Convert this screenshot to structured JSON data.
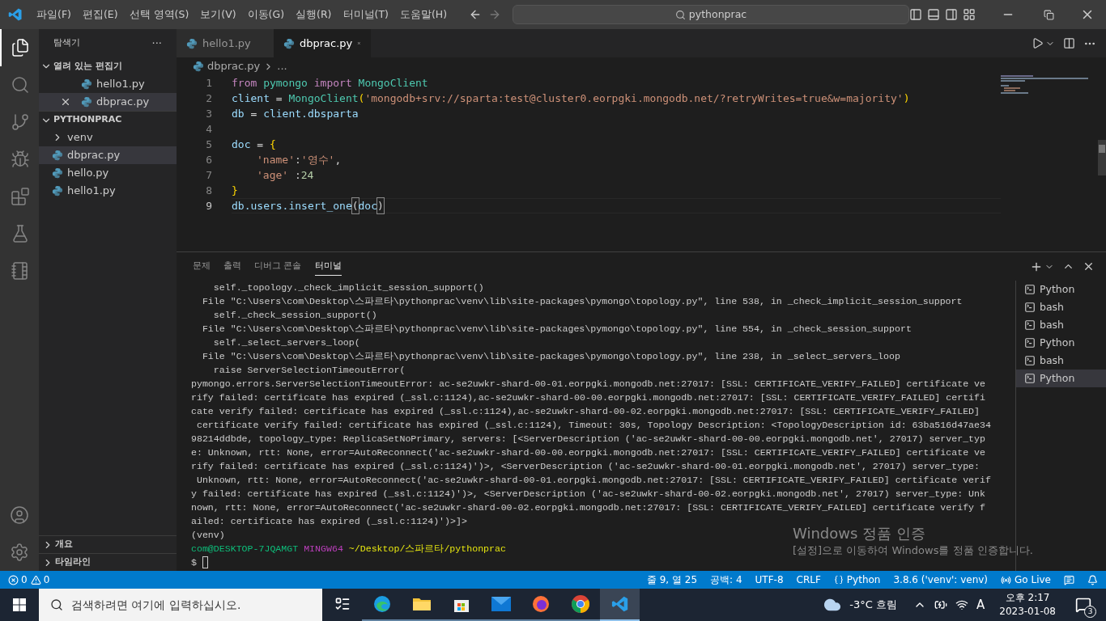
{
  "title_bar": {
    "menu": [
      "파일(F)",
      "편집(E)",
      "선택 영역(S)",
      "보기(V)",
      "이동(G)",
      "실행(R)",
      "터미널(T)",
      "도움말(H)"
    ],
    "search": "pythonprac"
  },
  "activity_bar": [
    {
      "kind": "files",
      "selected": true
    },
    {
      "kind": "search",
      "selected": false
    },
    {
      "kind": "git",
      "selected": false
    },
    {
      "kind": "debug",
      "selected": false
    },
    {
      "kind": "extensions",
      "selected": false
    },
    {
      "kind": "testing",
      "selected": false
    },
    {
      "kind": "notebook",
      "selected": false
    }
  ],
  "sidebar": {
    "title": "탐색기",
    "more": "···",
    "open_editors": {
      "label": "열려 있는 편집기",
      "expanded": true,
      "items": [
        {
          "name": "hello1.py",
          "selected": false
        },
        {
          "name": "dbprac.py",
          "selected": true
        }
      ]
    },
    "folder": {
      "label": "PYTHONPRAC",
      "expanded": true,
      "items": [
        {
          "name": "venv",
          "kind": "folder",
          "expanded": false,
          "selected": false
        },
        {
          "name": "dbprac.py",
          "kind": "file",
          "selected": true
        },
        {
          "name": "hello.py",
          "kind": "file",
          "selected": false
        },
        {
          "name": "hello1.py",
          "kind": "file",
          "selected": false
        }
      ]
    },
    "bottom_sections": [
      {
        "label": "개요",
        "expanded": false
      },
      {
        "label": "타임라인",
        "expanded": false
      }
    ]
  },
  "tabs": [
    {
      "name": "hello1.py",
      "selected": false
    },
    {
      "name": "dbprac.py",
      "selected": true
    }
  ],
  "breadcrumb": [
    "dbprac.py",
    "..."
  ],
  "code": [
    {
      "number": "1",
      "current": false,
      "tokens": [
        {
          "text": "from ",
          "kind": "keyword"
        },
        {
          "text": "pymongo ",
          "kind": "type"
        },
        {
          "text": "import ",
          "kind": "keyword"
        },
        {
          "text": "MongoClient",
          "kind": "type"
        }
      ]
    },
    {
      "number": "2",
      "current": false,
      "tokens": [
        {
          "text": "client",
          "kind": "var"
        },
        {
          "text": " = ",
          "kind": "plain"
        },
        {
          "text": "MongoClient",
          "kind": "type"
        },
        {
          "text": "(",
          "kind": "bracket"
        },
        {
          "text": "'mongodb+srv://sparta:test@cluster0.eorpgki.mongodb.net/?retryWrites=true&w=majority'",
          "kind": "string"
        },
        {
          "text": ")",
          "kind": "bracket"
        }
      ]
    },
    {
      "number": "3",
      "current": false,
      "tokens": [
        {
          "text": "db",
          "kind": "var"
        },
        {
          "text": " = ",
          "kind": "plain"
        },
        {
          "text": "client.dbsparta",
          "kind": "var"
        }
      ]
    },
    {
      "number": "4",
      "current": false
    },
    {
      "number": "5",
      "current": false,
      "tokens": [
        {
          "text": "doc",
          "kind": "var"
        },
        {
          "text": " = ",
          "kind": "plain"
        },
        {
          "text": "{",
          "kind": "bracket"
        }
      ]
    },
    {
      "number": "6",
      "current": false,
      "indented": true,
      "tokens": [
        {
          "text": "'name'",
          "kind": "string"
        },
        {
          "text": ":",
          "kind": "plain"
        },
        {
          "text": "'영수'",
          "kind": "string"
        },
        {
          "text": ",",
          "kind": "plain"
        }
      ]
    },
    {
      "number": "7",
      "current": false,
      "indented": true,
      "tokens": [
        {
          "text": "'age'",
          "kind": "string"
        },
        {
          "text": " :",
          "kind": "plain"
        },
        {
          "text": "24",
          "kind": "number"
        }
      ]
    },
    {
      "number": "8",
      "current": false,
      "tokens": [
        {
          "text": "}",
          "kind": "bracket"
        }
      ]
    },
    {
      "number": "9",
      "current": true,
      "tokens": [
        {
          "text": "db.users.insert_one",
          "kind": "var"
        },
        {
          "text": "(",
          "kind": "match"
        },
        {
          "text": "doc",
          "kind": "var"
        },
        {
          "text": ")",
          "kind": "match"
        }
      ]
    }
  ],
  "panel": {
    "tabs": [
      {
        "label": "문제",
        "selected": false
      },
      {
        "label": "출력",
        "selected": false
      },
      {
        "label": "디버그 콘솔",
        "selected": false
      },
      {
        "label": "터미널",
        "selected": true
      }
    ],
    "terminal": [
      [
        {
          "text": "    self._topology._check_implicit_session_support()",
          "kind": "plain"
        }
      ],
      [
        {
          "text": "  File \"C:\\Users\\com\\Desktop\\스파르타\\pythonprac\\venv\\lib\\site-packages\\pymongo\\topology.py\", line 538, in _check_implicit_session_support",
          "kind": "plain"
        }
      ],
      [
        {
          "text": "    self._check_session_support()",
          "kind": "plain"
        }
      ],
      [
        {
          "text": "  File \"C:\\Users\\com\\Desktop\\스파르타\\pythonprac\\venv\\lib\\site-packages\\pymongo\\topology.py\", line 554, in _check_session_support",
          "kind": "plain"
        }
      ],
      [
        {
          "text": "    self._select_servers_loop(",
          "kind": "plain"
        }
      ],
      [
        {
          "text": "  File \"C:\\Users\\com\\Desktop\\스파르타\\pythonprac\\venv\\lib\\site-packages\\pymongo\\topology.py\", line 238, in _select_servers_loop",
          "kind": "plain"
        }
      ],
      [
        {
          "text": "    raise ServerSelectionTimeoutError(",
          "kind": "plain"
        }
      ],
      [
        {
          "text": "pymongo.errors.ServerSelectionTimeoutError: ac-se2uwkr-shard-00-01.eorpgki.mongodb.net:27017: [SSL: CERTIFICATE_VERIFY_FAILED] certificate ve",
          "kind": "plain"
        }
      ],
      [
        {
          "text": "rify failed: certificate has expired (_ssl.c:1124),ac-se2uwkr-shard-00-00.eorpgki.mongodb.net:27017: [SSL: CERTIFICATE_VERIFY_FAILED] certifi",
          "kind": "plain"
        }
      ],
      [
        {
          "text": "cate verify failed: certificate has expired (_ssl.c:1124),ac-se2uwkr-shard-00-02.eorpgki.mongodb.net:27017: [SSL: CERTIFICATE_VERIFY_FAILED]",
          "kind": "plain"
        }
      ],
      [
        {
          "text": " certificate verify failed: certificate has expired (_ssl.c:1124), Timeout: 30s, Topology Description: <TopologyDescription id: 63ba516d47ae34",
          "kind": "plain"
        }
      ],
      [
        {
          "text": "98214ddbde, topology_type: ReplicaSetNoPrimary, servers: [<ServerDescription ('ac-se2uwkr-shard-00-00.eorpgki.mongodb.net', 27017) server_typ",
          "kind": "plain"
        }
      ],
      [
        {
          "text": "e: Unknown, rtt: None, error=AutoReconnect('ac-se2uwkr-shard-00-00.eorpgki.mongodb.net:27017: [SSL: CERTIFICATE_VERIFY_FAILED] certificate ve",
          "kind": "plain"
        }
      ],
      [
        {
          "text": "rify failed: certificate has expired (_ssl.c:1124)')>, <ServerDescription ('ac-se2uwkr-shard-00-01.eorpgki.mongodb.net', 27017) server_type:",
          "kind": "plain"
        }
      ],
      [
        {
          "text": " Unknown, rtt: None, error=AutoReconnect('ac-se2uwkr-shard-00-01.eorpgki.mongodb.net:27017: [SSL: CERTIFICATE_VERIFY_FAILED] certificate verif",
          "kind": "plain"
        }
      ],
      [
        {
          "text": "y failed: certificate has expired (_ssl.c:1124)')>, <ServerDescription ('ac-se2uwkr-shard-00-02.eorpgki.mongodb.net', 27017) server_type: Unk",
          "kind": "plain"
        }
      ],
      [
        {
          "text": "nown, rtt: None, error=AutoReconnect('ac-se2uwkr-shard-00-02.eorpgki.mongodb.net:27017: [SSL: CERTIFICATE_VERIFY_FAILED] certificate verify f",
          "kind": "plain"
        }
      ],
      [
        {
          "text": "ailed: certificate has expired (_ssl.c:1124)')>]>",
          "kind": "plain"
        }
      ],
      [
        {
          "text": "(venv)",
          "kind": "plain"
        }
      ],
      [
        {
          "text": "com@DESKTOP-7JQAMGT",
          "kind": "user"
        },
        {
          "text": " MINGW64",
          "kind": "system"
        },
        {
          "text": " ~/Desktop/스파르타/pythonprac",
          "kind": "path"
        }
      ],
      [
        {
          "text": "$ ",
          "kind": "plain"
        },
        {
          "kind": "cursor"
        }
      ]
    ],
    "sessions": [
      {
        "name": "Python",
        "selected": false
      },
      {
        "name": "bash",
        "selected": false
      },
      {
        "name": "bash",
        "selected": false
      },
      {
        "name": "Python",
        "selected": false
      },
      {
        "name": "bash",
        "selected": false
      },
      {
        "name": "Python",
        "selected": true
      }
    ]
  },
  "activation_notice": {
    "title": "Windows 정품 인증",
    "text": "[설정]으로 이동하여 Windows를 정품 인증합니다."
  },
  "status_bar": {
    "errors": "0",
    "warnings": "0",
    "position": "줄 9, 열 25",
    "spaces": "공백: 4",
    "encoding": "UTF-8",
    "eol": "CRLF",
    "language": "Python",
    "interpreter": "3.8.6 ('venv': venv)",
    "live": "Go Live"
  },
  "taskbar": {
    "search_placeholder": "검색하려면 여기에 입력하십시오.",
    "apps": [
      {
        "kind": "taskview",
        "selected": false
      },
      {
        "kind": "edge",
        "selected": false
      },
      {
        "kind": "explorer",
        "selected": false
      },
      {
        "kind": "store",
        "selected": false
      },
      {
        "kind": "mail",
        "selected": false
      },
      {
        "kind": "firefox",
        "selected": false
      },
      {
        "kind": "chrome",
        "selected": false
      },
      {
        "kind": "vscode",
        "selected": true
      }
    ],
    "weather": "-3°C 흐림",
    "input_lang": "A",
    "time": "오후 2:17",
    "date": "2023-01-08",
    "notifications": "3"
  }
}
